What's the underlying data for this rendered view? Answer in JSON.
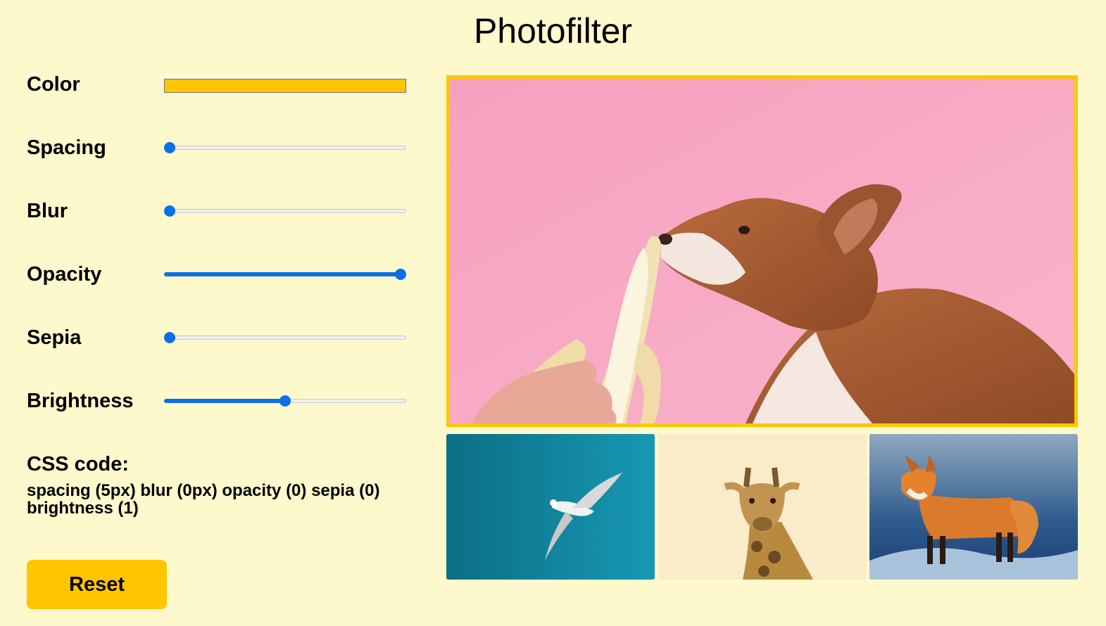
{
  "header": {
    "title": "Photofilter"
  },
  "controls": {
    "color": {
      "label": "Color",
      "value": "#ffc600"
    },
    "spacing": {
      "label": "Spacing",
      "value": 0.0
    },
    "blur": {
      "label": "Blur",
      "value": 0.0
    },
    "opacity": {
      "label": "Opacity",
      "value": 1.0
    },
    "sepia": {
      "label": "Sepia",
      "value": 0.0
    },
    "brightness": {
      "label": "Brightness",
      "value": 0.5
    }
  },
  "css_code": {
    "label": "CSS code:",
    "text": "spacing (5px) blur (0px) opacity (0) sepia (0) brightness (1)"
  },
  "reset_label": "Reset",
  "colors": {
    "background": "#fef9cc",
    "accent": "#ffc600",
    "slider": "#0a6fe8"
  },
  "gallery": {
    "main_image": "dog-sniffing-banana",
    "thumbnails": [
      "seagull-flying",
      "giraffe-head",
      "red-fox"
    ]
  }
}
